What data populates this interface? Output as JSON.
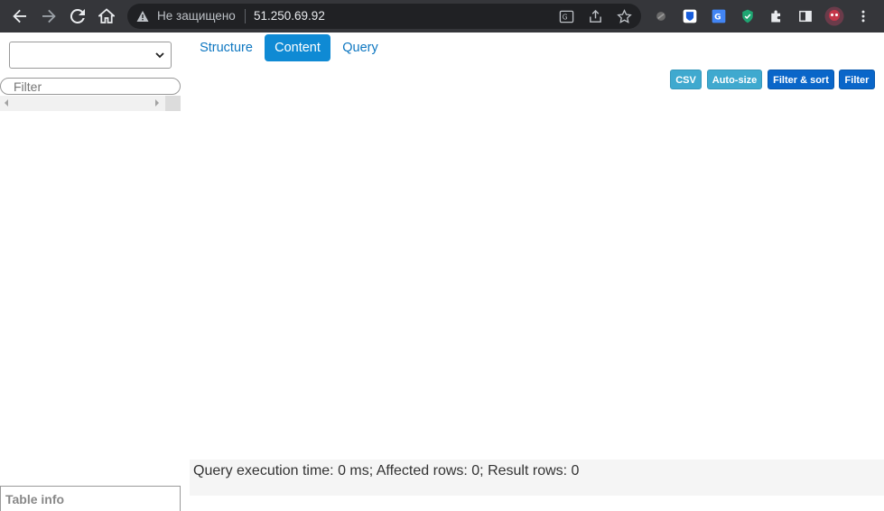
{
  "browser": {
    "security_label": "Не защищено",
    "url": "51.250.69.92"
  },
  "sidebar": {
    "database_select_value": "",
    "filter_placeholder": "Filter",
    "table_info_label": "Table info"
  },
  "tabs": [
    {
      "label": "Structure",
      "active": false
    },
    {
      "label": "Content",
      "active": true
    },
    {
      "label": "Query",
      "active": false
    }
  ],
  "toolbar": {
    "csv_label": "CSV",
    "autosize_label": "Auto-size",
    "filter_sort_label": "Filter & sort",
    "filter_label": "Filter"
  },
  "status": {
    "text": "Query execution time: 0 ms; Affected rows: 0; Result rows: 0"
  },
  "colors": {
    "chrome_bg": "#35363a",
    "omnibox_bg": "#202124",
    "tab_active": "#0f8ad4",
    "link": "#0e77c1",
    "btn_info": "#3fa9cf",
    "btn_primary": "#0a66c9"
  }
}
